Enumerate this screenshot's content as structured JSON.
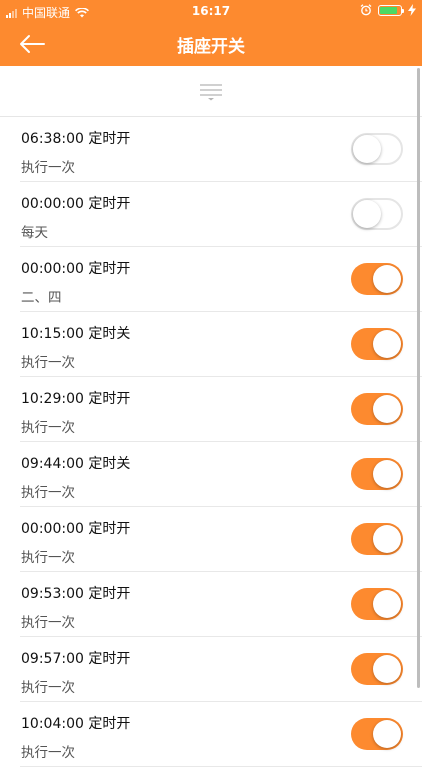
{
  "status_bar": {
    "carrier": "中国联通",
    "time": "16:17",
    "icons": [
      "signal-icon",
      "wifi-icon",
      "alarm-icon",
      "battery-icon",
      "charging-icon"
    ]
  },
  "nav": {
    "title": "插座开关",
    "back_icon": "back-arrow-icon"
  },
  "filter": {
    "icon": "filter-icon"
  },
  "colors": {
    "accent": "#fd8a2f",
    "battery": "#4cd964"
  },
  "timers": [
    {
      "time": "06:38:00",
      "action": "定时开",
      "repeat": "执行一次",
      "enabled": false
    },
    {
      "time": "00:00:00",
      "action": "定时开",
      "repeat": "每天",
      "enabled": false
    },
    {
      "time": "00:00:00",
      "action": "定时开",
      "repeat": "二、四",
      "enabled": true
    },
    {
      "time": "10:15:00",
      "action": "定时关",
      "repeat": "执行一次",
      "enabled": true
    },
    {
      "time": "10:29:00",
      "action": "定时开",
      "repeat": "执行一次",
      "enabled": true
    },
    {
      "time": "09:44:00",
      "action": "定时关",
      "repeat": "执行一次",
      "enabled": true
    },
    {
      "time": "00:00:00",
      "action": "定时开",
      "repeat": "执行一次",
      "enabled": true
    },
    {
      "time": "09:53:00",
      "action": "定时开",
      "repeat": "执行一次",
      "enabled": true
    },
    {
      "time": "09:57:00",
      "action": "定时开",
      "repeat": "执行一次",
      "enabled": true
    },
    {
      "time": "10:04:00",
      "action": "定时开",
      "repeat": "执行一次",
      "enabled": true
    }
  ]
}
